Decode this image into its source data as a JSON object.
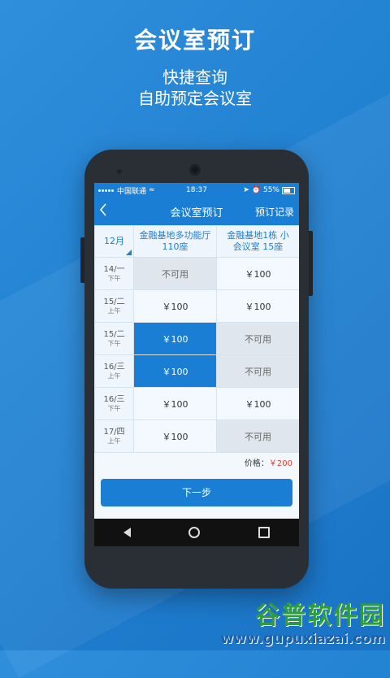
{
  "hero": {
    "title": "会议室预订",
    "subtitle_lines": [
      "快捷查询",
      "自助预定会议室"
    ]
  },
  "statusbar": {
    "carrier": "中国联通",
    "time": "18:37",
    "battery": "55%"
  },
  "navbar": {
    "back_icon": "chevron-left-icon",
    "title": "会议室预订",
    "link": "预订记录"
  },
  "grid": {
    "month": "12月",
    "rooms": [
      "金融基地多功能厅 110座",
      "金融基地1栋 小会议室 15座"
    ],
    "rows": [
      {
        "date": "14/一",
        "period": "下午",
        "cells": [
          {
            "text": "不可用",
            "state": "na"
          },
          {
            "text": "￥100",
            "state": "avail"
          }
        ]
      },
      {
        "date": "15/二",
        "period": "上午",
        "cells": [
          {
            "text": "￥100",
            "state": "avail"
          },
          {
            "text": "￥100",
            "state": "avail"
          }
        ]
      },
      {
        "date": "15/二",
        "period": "下午",
        "cells": [
          {
            "text": "￥100",
            "state": "selected"
          },
          {
            "text": "不可用",
            "state": "na"
          }
        ]
      },
      {
        "date": "16/三",
        "period": "上午",
        "cells": [
          {
            "text": "￥100",
            "state": "selected"
          },
          {
            "text": "不可用",
            "state": "na"
          }
        ]
      },
      {
        "date": "16/三",
        "period": "下午",
        "cells": [
          {
            "text": "￥100",
            "state": "avail"
          },
          {
            "text": "￥100",
            "state": "avail"
          }
        ]
      },
      {
        "date": "17/四",
        "period": "上午",
        "cells": [
          {
            "text": "￥100",
            "state": "avail"
          },
          {
            "text": "不可用",
            "state": "na"
          }
        ]
      }
    ]
  },
  "price": {
    "label": "价格：",
    "value": "￥200"
  },
  "next_button": "下一步",
  "watermark": {
    "line1": "谷普软件园",
    "line2": "www.gupuxiazai.com"
  },
  "colors": {
    "primary": "#1a7fd4",
    "price": "#e53935"
  }
}
